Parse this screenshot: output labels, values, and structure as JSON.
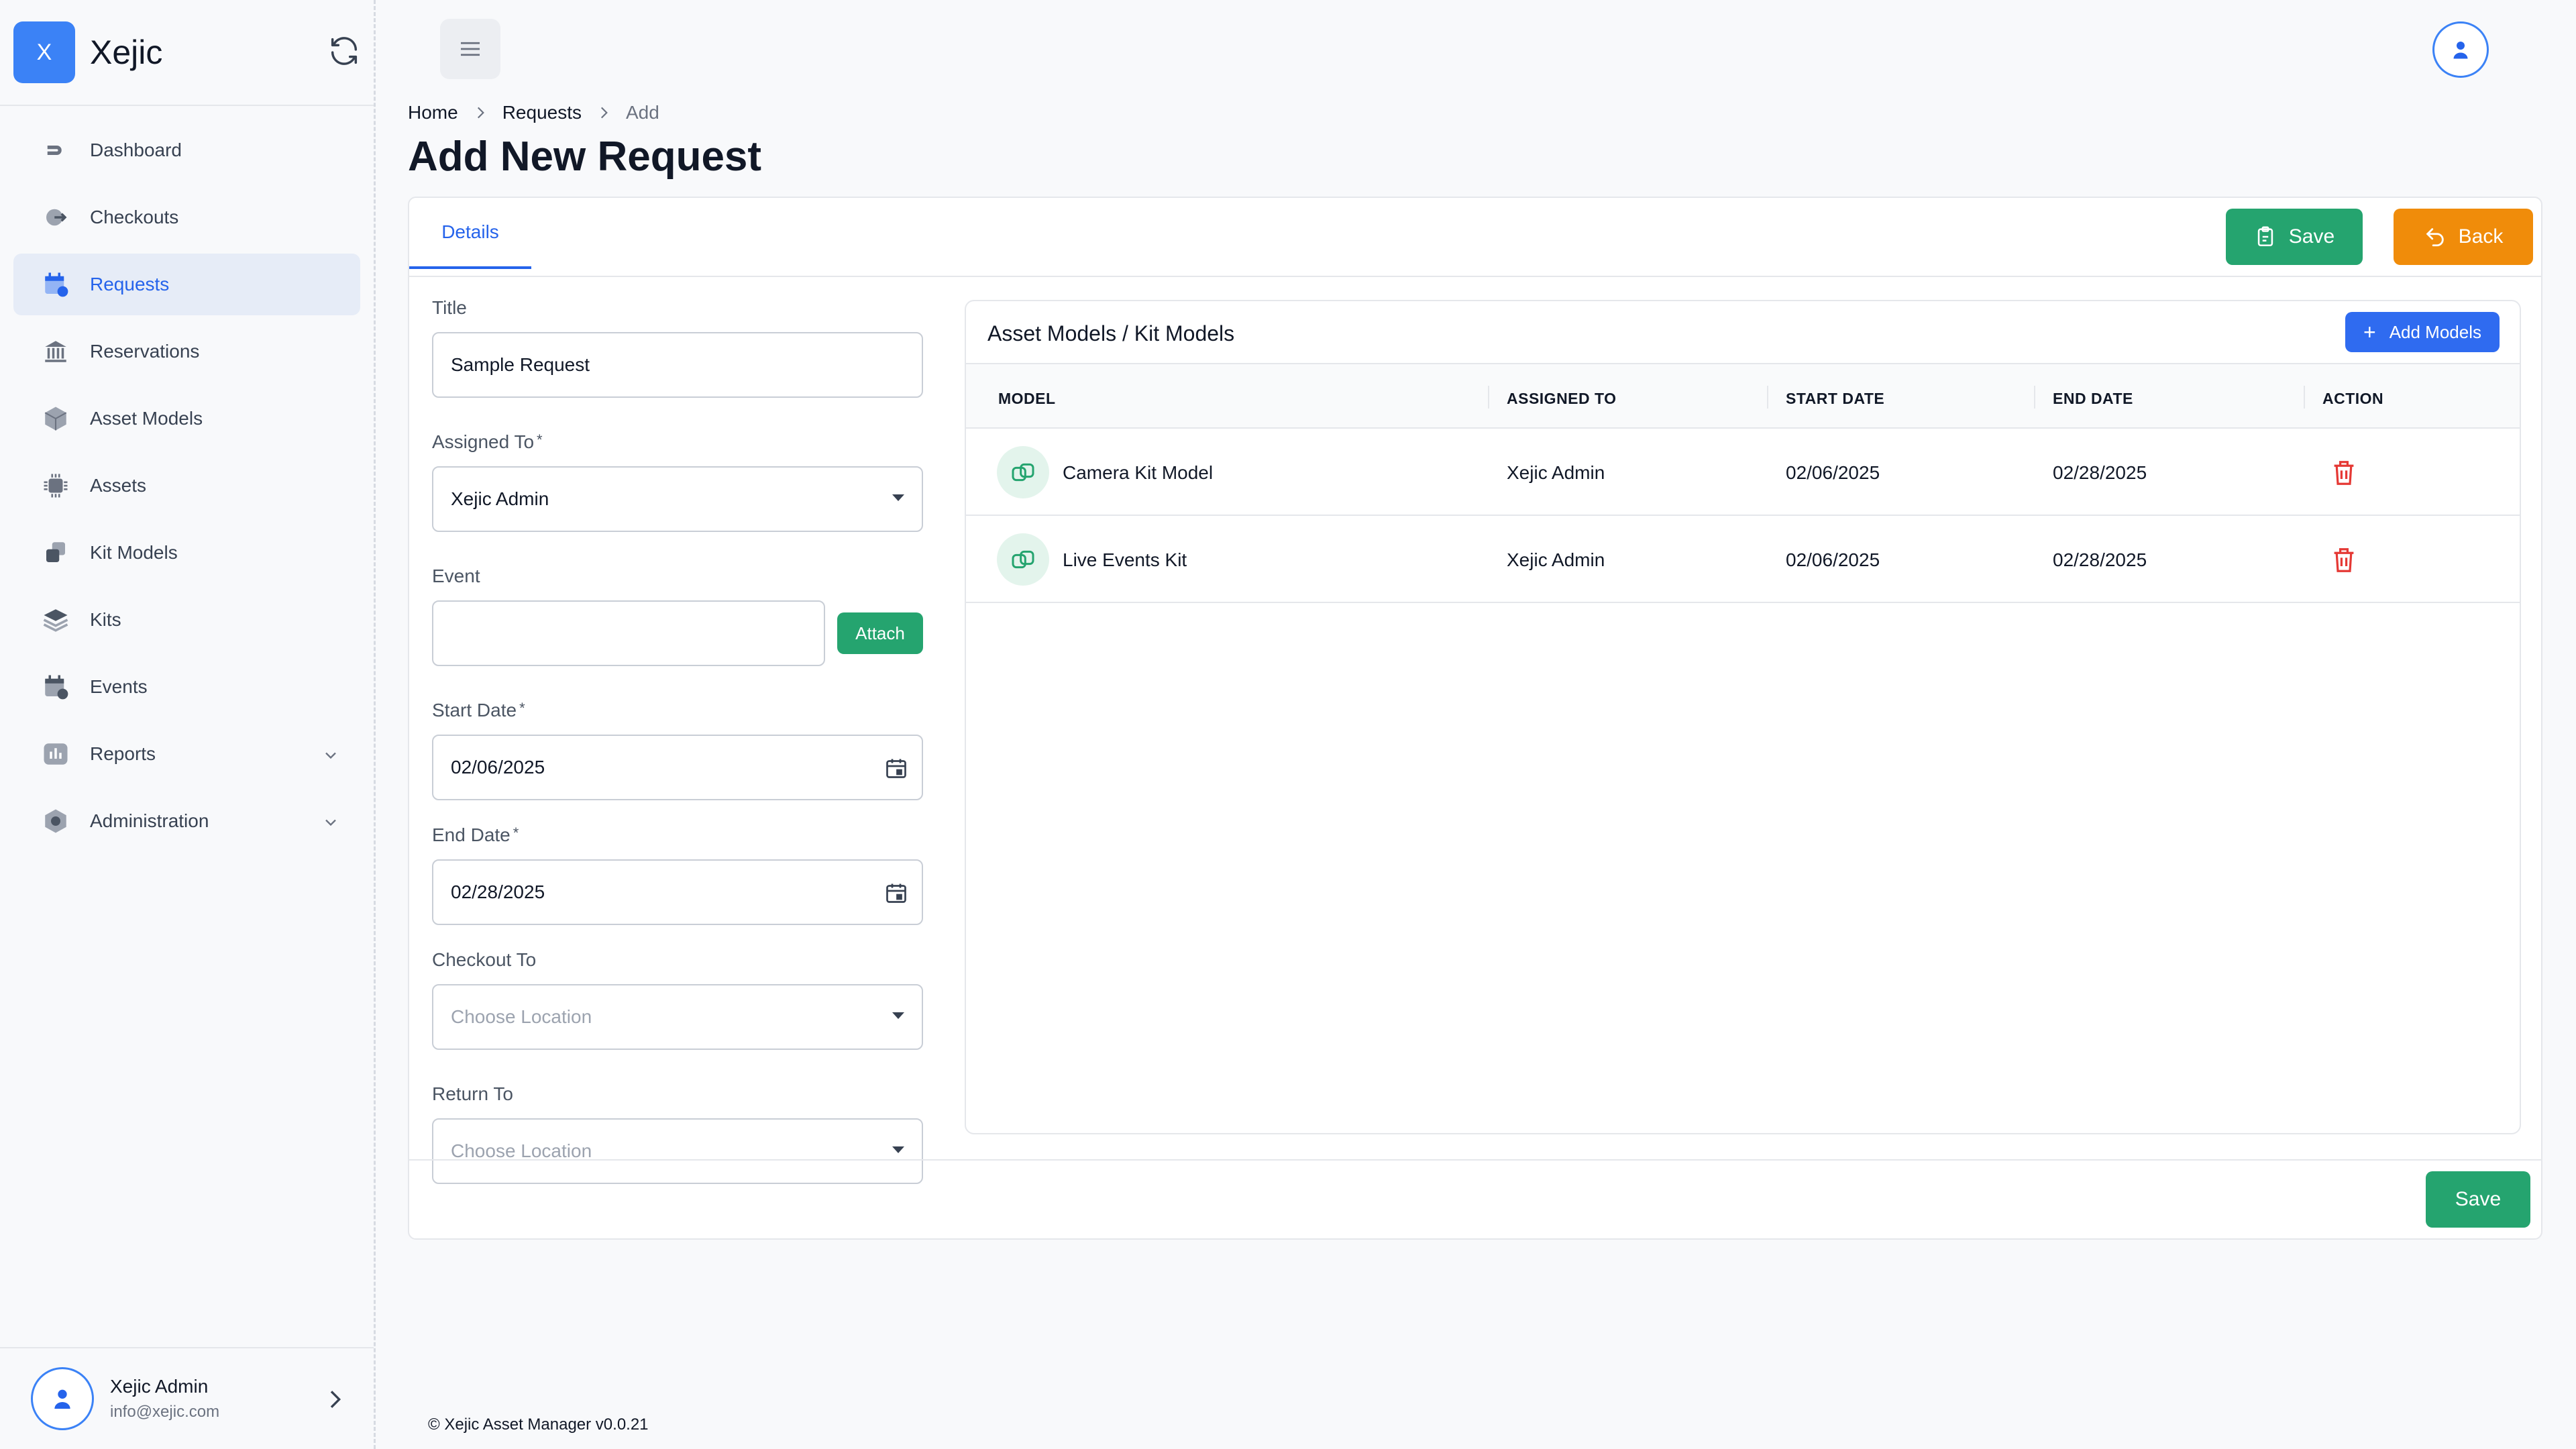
{
  "brand": {
    "logo_letter": "X",
    "name": "Xejic"
  },
  "sidebar": {
    "items": [
      {
        "label": "Dashboard",
        "icon": "dashboard-icon"
      },
      {
        "label": "Checkouts",
        "icon": "checkout-icon"
      },
      {
        "label": "Requests",
        "icon": "calendar-request-icon",
        "active": true
      },
      {
        "label": "Reservations",
        "icon": "building-icon"
      },
      {
        "label": "Asset Models",
        "icon": "cube-icon"
      },
      {
        "label": "Assets",
        "icon": "chip-icon"
      },
      {
        "label": "Kit Models",
        "icon": "kit-model-icon"
      },
      {
        "label": "Kits",
        "icon": "layers-icon"
      },
      {
        "label": "Events",
        "icon": "event-calendar-icon"
      },
      {
        "label": "Reports",
        "icon": "report-icon",
        "expandable": true
      },
      {
        "label": "Administration",
        "icon": "settings-hex-icon",
        "expandable": true
      }
    ]
  },
  "user": {
    "name": "Xejic Admin",
    "email": "info@xejic.com"
  },
  "breadcrumb": [
    "Home",
    "Requests",
    "Add"
  ],
  "page": {
    "title": "Add New Request"
  },
  "tabs": [
    {
      "label": "Details"
    }
  ],
  "toolbar": {
    "save_label": "Save",
    "back_label": "Back"
  },
  "form": {
    "title_label": "Title",
    "title_value": "Sample Request",
    "assigned_label": "Assigned To",
    "assigned_value": "Xejic Admin",
    "event_label": "Event",
    "event_value": "",
    "attach_label": "Attach",
    "start_label": "Start Date",
    "start_value": "02/06/2025",
    "end_label": "End Date",
    "end_value": "02/28/2025",
    "checkout_label": "Checkout To",
    "checkout_placeholder": "Choose Location",
    "return_label": "Return To",
    "return_placeholder": "Choose Location",
    "required_mark": "*"
  },
  "models": {
    "title": "Asset Models / Kit Models",
    "add_label": "Add Models",
    "add_icon": "+",
    "columns": [
      "MODEL",
      "ASSIGNED TO",
      "START DATE",
      "END DATE",
      "ACTION"
    ],
    "rows": [
      {
        "model": "Camera Kit Model",
        "assigned": "Xejic Admin",
        "start": "02/06/2025",
        "end": "02/28/2025"
      },
      {
        "model": "Live Events Kit",
        "assigned": "Xejic Admin",
        "start": "02/06/2025",
        "end": "02/28/2025"
      }
    ]
  },
  "footer": {
    "save_label": "Save",
    "copyright": "© Xejic Asset Manager v0.0.21"
  },
  "colors": {
    "primary": "#2563eb",
    "success": "#25a46f",
    "warning": "#f08c0a",
    "danger": "#e53935"
  }
}
